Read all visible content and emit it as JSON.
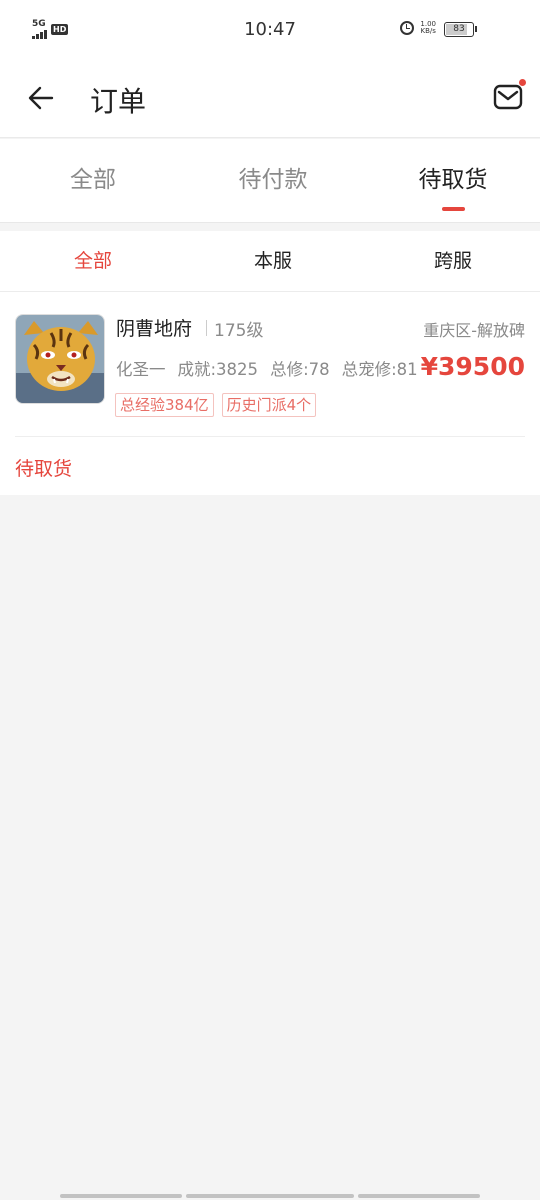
{
  "status_bar": {
    "network": "5G",
    "hd_badge": "HD",
    "time": "10:47",
    "net_speed_value": "1.00",
    "net_speed_unit": "KB/s",
    "battery": "83",
    "battery_level": 0.83,
    "icons": [
      "signal-icon",
      "alarm-clock-icon",
      "battery-icon"
    ]
  },
  "header": {
    "title": "订单",
    "back_icon": "arrow-left-icon",
    "mail_icon": "mail-icon",
    "has_notification_dot": true
  },
  "tabs": [
    {
      "label": "全部",
      "active": false
    },
    {
      "label": "待付款",
      "active": false
    },
    {
      "label": "待取货",
      "active": true
    }
  ],
  "subtabs": [
    {
      "label": "全部",
      "active": true
    },
    {
      "label": "本服",
      "active": false
    },
    {
      "label": "跨服",
      "active": false
    }
  ],
  "orders": [
    {
      "avatar": "tiger-warrior-avatar",
      "role_name": "阴曹地府",
      "level": "175级",
      "server": "重庆区-解放碑",
      "stats": [
        "化圣一",
        "成就:3825",
        "总修:78",
        "总宠修:81"
      ],
      "price": "¥39500",
      "tags": [
        "总经验384亿",
        "历史门派4个"
      ],
      "status": "待取货"
    }
  ],
  "colors": {
    "accent": "#e5463d",
    "text_primary": "#222222",
    "text_secondary": "#8a8a8a",
    "page_background": "#f4f4f4"
  }
}
